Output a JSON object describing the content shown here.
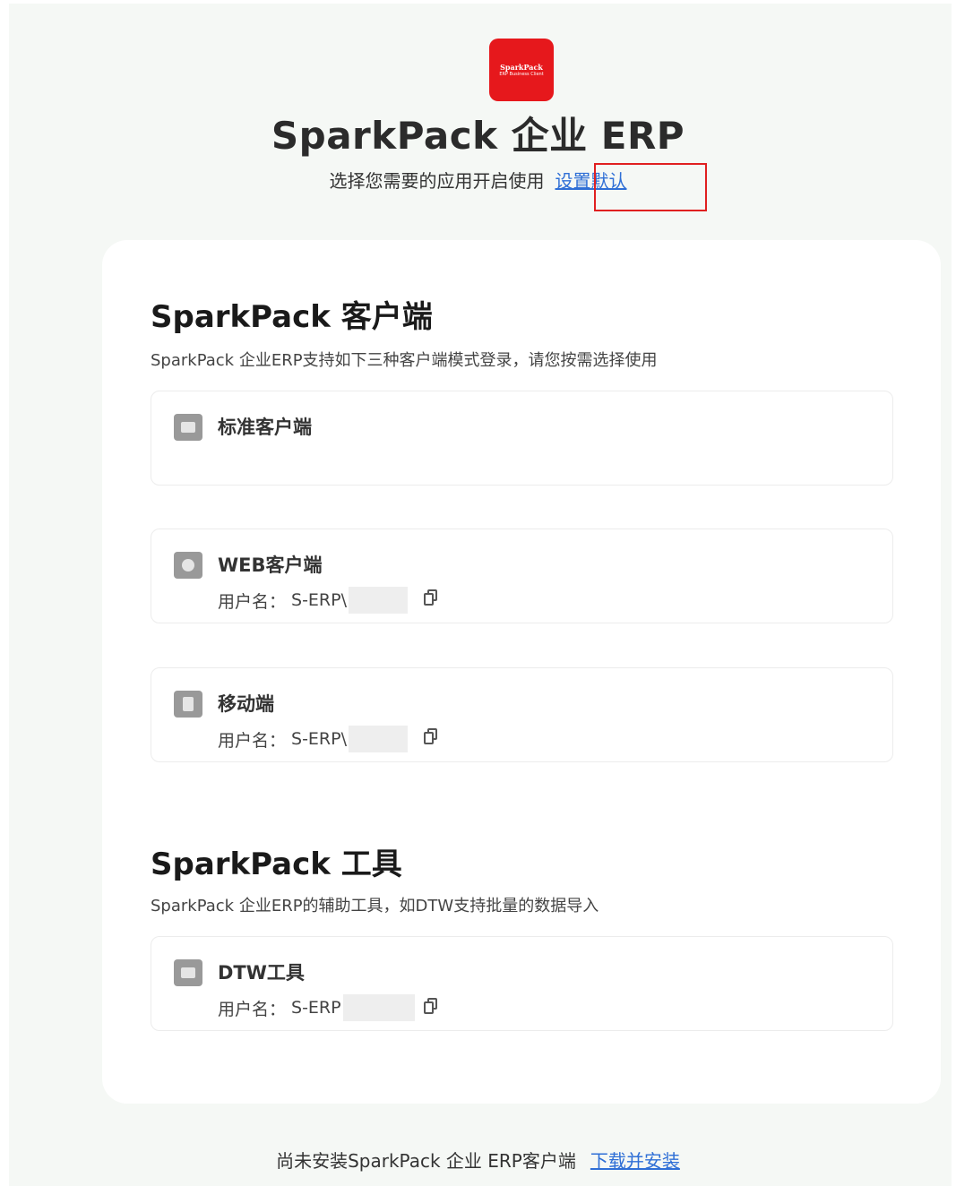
{
  "header": {
    "logo_line1": "SparkPack",
    "logo_line2": "ERP Business Client",
    "title": "SparkPack 企业 ERP",
    "subtitle": "选择您需要的应用开启使用",
    "set_default_link": "设置默认"
  },
  "clients_section": {
    "title": "SparkPack 客户端",
    "description": "SparkPack 企业ERP支持如下三种客户端模式登录，请您按需选择使用",
    "items": [
      {
        "name": "标准客户端",
        "icon": "monitor-icon"
      },
      {
        "name": "WEB客户端",
        "icon": "globe-icon",
        "user_label": "用户名：",
        "user_value": "S-ERP\\"
      },
      {
        "name": "移动端",
        "icon": "mobile-icon",
        "user_label": "用户名：",
        "user_value": "S-ERP\\"
      }
    ]
  },
  "tools_section": {
    "title": "SparkPack 工具",
    "description": "SparkPack 企业ERP的辅助工具，如DTW支持批量的数据导入",
    "items": [
      {
        "name": "DTW工具",
        "icon": "tool-icon",
        "user_label": "用户名：",
        "user_value": "S-ERP"
      }
    ]
  },
  "footer": {
    "text": "尚未安装SparkPack 企业 ERP客户端",
    "download_link": "下载并安装"
  },
  "colors": {
    "brand_red": "#e6181c",
    "link_blue": "#2f6fd6",
    "highlight_red": "#e02020"
  }
}
